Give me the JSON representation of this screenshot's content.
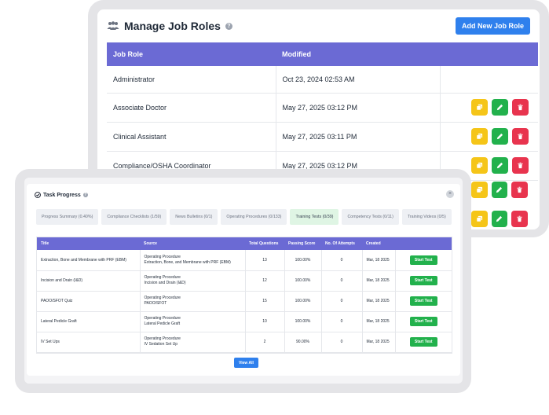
{
  "job_roles": {
    "title": "Manage Job Roles",
    "add_button": "Add New Job Role",
    "columns": [
      "Job Role",
      "Modified"
    ],
    "rows": [
      {
        "role": "Administrator",
        "modified": "Oct 23, 2024 02:53 AM"
      },
      {
        "role": "Associate Doctor",
        "modified": "May 27, 2025 03:12 PM"
      },
      {
        "role": "Clinical Assistant",
        "modified": "May 27, 2025 03:11 PM"
      },
      {
        "role": "Compliance/OSHA Coordinator",
        "modified": "May 27, 2025 03:12 PM"
      }
    ]
  },
  "task_progress": {
    "title": "Task Progress",
    "tabs": [
      "Progress Summary (0.40%)",
      "Compliance Checklists (1/59)",
      "News Bulletins (0/1)",
      "Operating Procedures (0/133)",
      "Training Tests (0/39)",
      "Competency Tests (0/11)",
      "Training Videos (0/5)"
    ],
    "active_tab": "Training Tests (0/39)",
    "columns": [
      "Title",
      "Source",
      "Total Questions",
      "Passing Score",
      "No. Of Attempts",
      "Created"
    ],
    "rows": [
      {
        "title": "Extraction, Bone and Membrane with PRF (EBM)",
        "source_type": "Operating Procedure",
        "source_name": "Extraction, Bone, and Membrane with PRF (EBM)",
        "questions": "13",
        "passing": "100.00%",
        "attempts": "0",
        "created": "Mar, 18 2025",
        "action": "Start Test"
      },
      {
        "title": "Incision and Drain (I&D)",
        "source_type": "Operating Procedure",
        "source_name": "Incision and Drain (I&D)",
        "questions": "12",
        "passing": "100.00%",
        "attempts": "0",
        "created": "Mar, 18 2025",
        "action": "Start Test"
      },
      {
        "title": "PAOO/SFOT Quiz",
        "source_type": "Operating Procedure",
        "source_name": "PAOO/SFOT",
        "questions": "15",
        "passing": "100.00%",
        "attempts": "0",
        "created": "Mar, 18 2025",
        "action": "Start Test"
      },
      {
        "title": "Lateral Pedicle Graft",
        "source_type": "Operating Procedure",
        "source_name": "Lateral Pedicle Graft",
        "questions": "10",
        "passing": "100.00%",
        "attempts": "0",
        "created": "Mar, 18 2025",
        "action": "Start Test"
      },
      {
        "title": "IV Set Ups",
        "source_type": "Operating Procedure",
        "source_name": "IV Sedation Set Up",
        "questions": "2",
        "passing": "90.00%",
        "attempts": "0",
        "created": "Mar, 18 2025",
        "action": "Start Test"
      }
    ],
    "view_all": "View All"
  },
  "colors": {
    "header_purple": "#6b6ad4",
    "primary_blue": "#2f80ed",
    "copy_yellow": "#f5c518",
    "edit_green": "#22b14c",
    "delete_red": "#e8344e",
    "active_tab_green": "#dff5e4"
  },
  "icons": [
    "users-icon",
    "help-icon",
    "copy-icon",
    "pencil-icon",
    "trash-icon",
    "check-circle-icon",
    "close-icon"
  ]
}
